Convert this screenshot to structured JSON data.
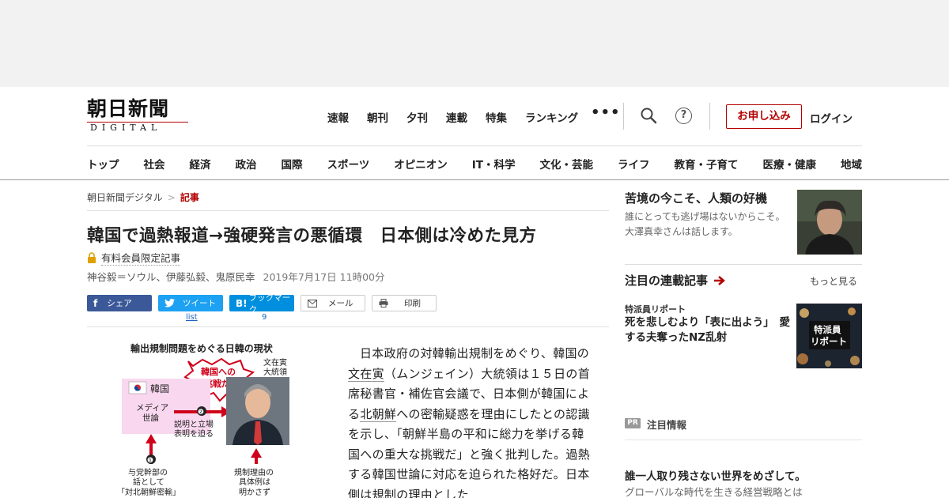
{
  "logo": {
    "main": "朝日新聞",
    "sub": "DIGITAL"
  },
  "topnav": [
    "速報",
    "朝刊",
    "夕刊",
    "連載",
    "特集",
    "ランキング"
  ],
  "header": {
    "more": "•••",
    "subscribe": "お申し込み",
    "login": "ログイン",
    "help": "?"
  },
  "catnav": [
    "トップ",
    "社会",
    "経済",
    "政治",
    "国際",
    "スポーツ",
    "オピニオン",
    "IT・科学",
    "文化・芸能",
    "ライフ",
    "教育・子育て",
    "医療・健康",
    "地域"
  ],
  "breadcrumb": {
    "home": "朝日新聞デジタル",
    "sep": ">",
    "current": "記事"
  },
  "article": {
    "title": "韓国で過熱報道→強硬発言の悪循環　日本側は冷めた見方",
    "members_only": "有料会員限定記事",
    "authors": "神谷毅＝ソウル、伊藤弘毅、鬼原民幸",
    "date": "2019年7月17日 11時00分",
    "body": {
      "p1": "日本政府の対韓輸出規制をめぐり、韓国の",
      "link1": "文在寅",
      "p2": "（ムンジェイン）大統領は１５日の首席秘書官・補佐官会議で、日本側が韓国による",
      "link2": "北朝鮮",
      "p3": "への密輸疑惑を理由にしたとの認識を示し、「朝鮮半島の平和に総力を挙げる韓国への重大な挑戦だ」と強く批判した。過熱する韓国世論に対応を迫られた格好だ。日本側は規制の理由とした"
    }
  },
  "share": {
    "facebook": "シェア",
    "twitter": "ツイート",
    "hatena": "ブックマーク",
    "hatena_icon": "B!",
    "mail": "メール",
    "print": "印刷",
    "twitter_count": "list",
    "hatena_count": "9"
  },
  "figure": {
    "heading": "輸出規制問題をめぐる日韓の現状",
    "bubble1": "韓国への",
    "bubble2": "挑戦だ",
    "speaker1": "文在寅",
    "speaker2": "大統領",
    "korea": "韓国",
    "media1": "メディア",
    "media2": "世論",
    "step2": "❷",
    "explain1": "説明と立場",
    "explain2": "表明を迫る",
    "step1": "❶",
    "cap1a": "与党幹部の",
    "cap1b": "話として",
    "cap1c": "「対北朝鮮密輸」",
    "cap2a": "規制理由の",
    "cap2b": "具体例は",
    "cap2c": "明かさず"
  },
  "sidebar": {
    "feature_title": "苦境の今こそ、人類の好機",
    "feature_desc": "誰にとっても逃げ場はないからこそ。大澤真幸さんは話します。",
    "serial_heading": "注目の連載記事",
    "serial_more": "もっと見る",
    "serial_tag": "特派員リポート",
    "serial_title": "死を悲しむより「表に出よう」　愛する夫奪ったNZ乱射",
    "serial_img_label1": "特派員",
    "serial_img_label2": "リポート",
    "pr_badge": "PR",
    "pr_label": "注目情報",
    "pr_title": "誰一人取り残さない世界をめざして。",
    "pr_desc": "グローバルな時代を生きる経営戦略とは"
  },
  "colors": {
    "brand_red": "#b40000",
    "facebook": "#3b5998",
    "twitter": "#1da1f2",
    "hatena": "#008fde"
  }
}
